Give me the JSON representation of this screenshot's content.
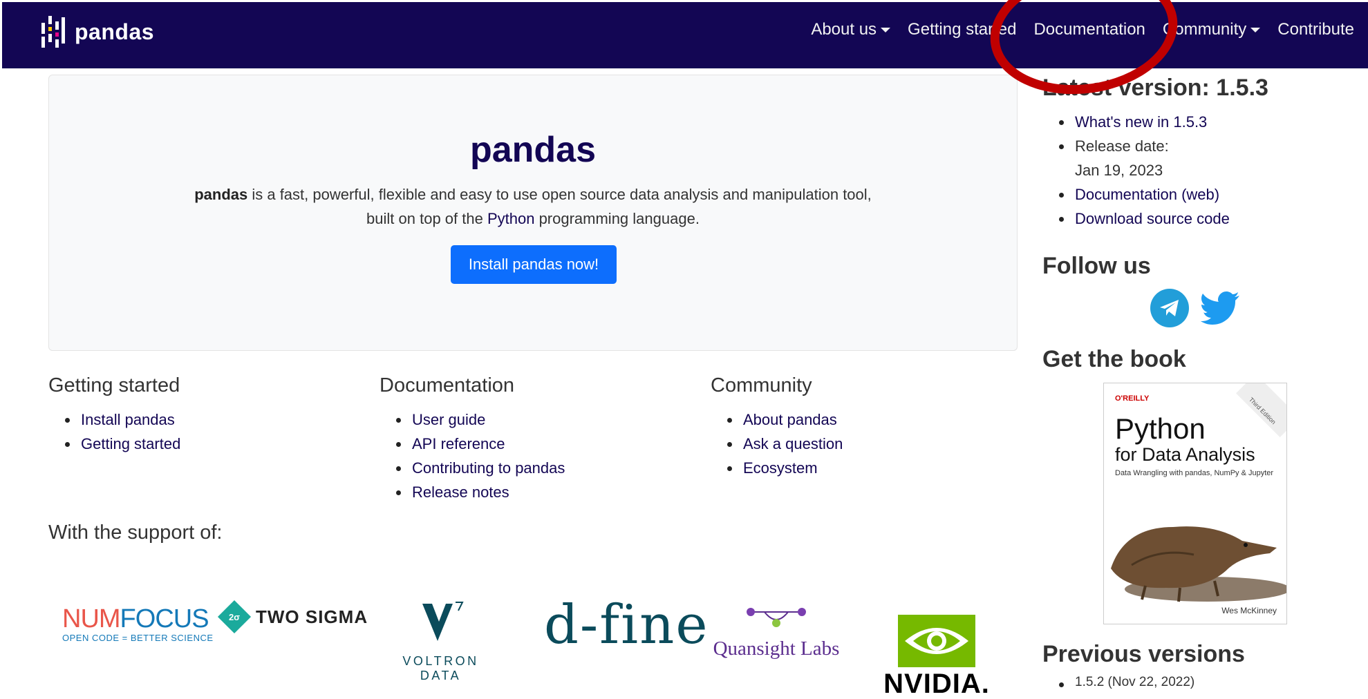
{
  "navbar": {
    "brand": "pandas",
    "items": [
      {
        "label": "About us",
        "dropdown": true
      },
      {
        "label": "Getting started",
        "dropdown": false
      },
      {
        "label": "Documentation",
        "dropdown": false
      },
      {
        "label": "Community",
        "dropdown": true
      },
      {
        "label": "Contribute",
        "dropdown": false
      }
    ]
  },
  "jumbotron": {
    "title": "pandas",
    "desc_bold": "pandas",
    "desc_part1": " is a fast, powerful, flexible and easy to use open source data analysis and manipulation tool,",
    "desc_part2": "built on top of the ",
    "desc_link": "Python",
    "desc_part3": " programming language.",
    "button": "Install pandas now!"
  },
  "sections": {
    "getting_started": {
      "title": "Getting started",
      "items": [
        "Install pandas",
        "Getting started"
      ]
    },
    "documentation": {
      "title": "Documentation",
      "items": [
        "User guide",
        "API reference",
        "Contributing to pandas",
        "Release notes"
      ]
    },
    "community": {
      "title": "Community",
      "items": [
        "About pandas",
        "Ask a question",
        "Ecosystem"
      ]
    }
  },
  "support": {
    "title": "With the support of:",
    "numfocus": {
      "num": "NUM",
      "focus": "FOCUS",
      "sub": "OPEN CODE = BETTER SCIENCE"
    },
    "twosigma": {
      "icon": "2σ",
      "name": "TWO SIGMA"
    },
    "voltron": {
      "name": "VOLTRON DATA"
    },
    "dfine": {
      "name": "d-fine"
    },
    "quansight": {
      "name": "Quansight Labs"
    },
    "nvidia": {
      "name": "NVIDIA."
    }
  },
  "sidebar": {
    "latest_title": "Latest version: 1.5.3",
    "latest_items": [
      "What's new in 1.5.3",
      "Documentation (web)",
      "Download source code"
    ],
    "release_label": "Release date:",
    "release_date": "Jan 19, 2023",
    "follow_title": "Follow us",
    "book_title": "Get the book",
    "book": {
      "publisher": "O'REILLY",
      "edition": "Third Edition",
      "title1": "Python",
      "title2": "for Data Analysis",
      "subtitle": "Data Wrangling with pandas, NumPy & Jupyter",
      "author": "Wes McKinney"
    },
    "prev_title": "Previous versions",
    "prev_items": [
      "1.5.2 (Nov 22, 2022)"
    ]
  },
  "colors": {
    "navbar": "#130654",
    "primary_button": "#0d6efd",
    "annotation": "#c00000"
  }
}
